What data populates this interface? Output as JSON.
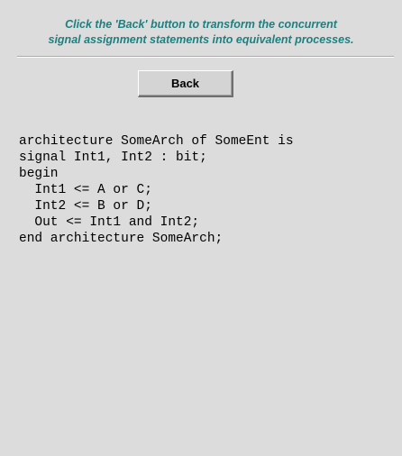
{
  "instruction": {
    "line1": "Click the 'Back' button to transform the concurrent",
    "line2": "signal assignment statements into equivalent processes."
  },
  "back_button": {
    "label": "Back"
  },
  "code": {
    "lines": [
      "architecture SomeArch of SomeEnt is",
      "signal Int1, Int2 : bit;",
      "begin",
      "  Int1 <= A or C;",
      "  Int2 <= B or D;",
      "  Out <= Int1 and Int2;",
      "end architecture SomeArch;"
    ]
  },
  "colors": {
    "background": "#dcdcdc",
    "instruction_text": "#1f7f7f"
  }
}
